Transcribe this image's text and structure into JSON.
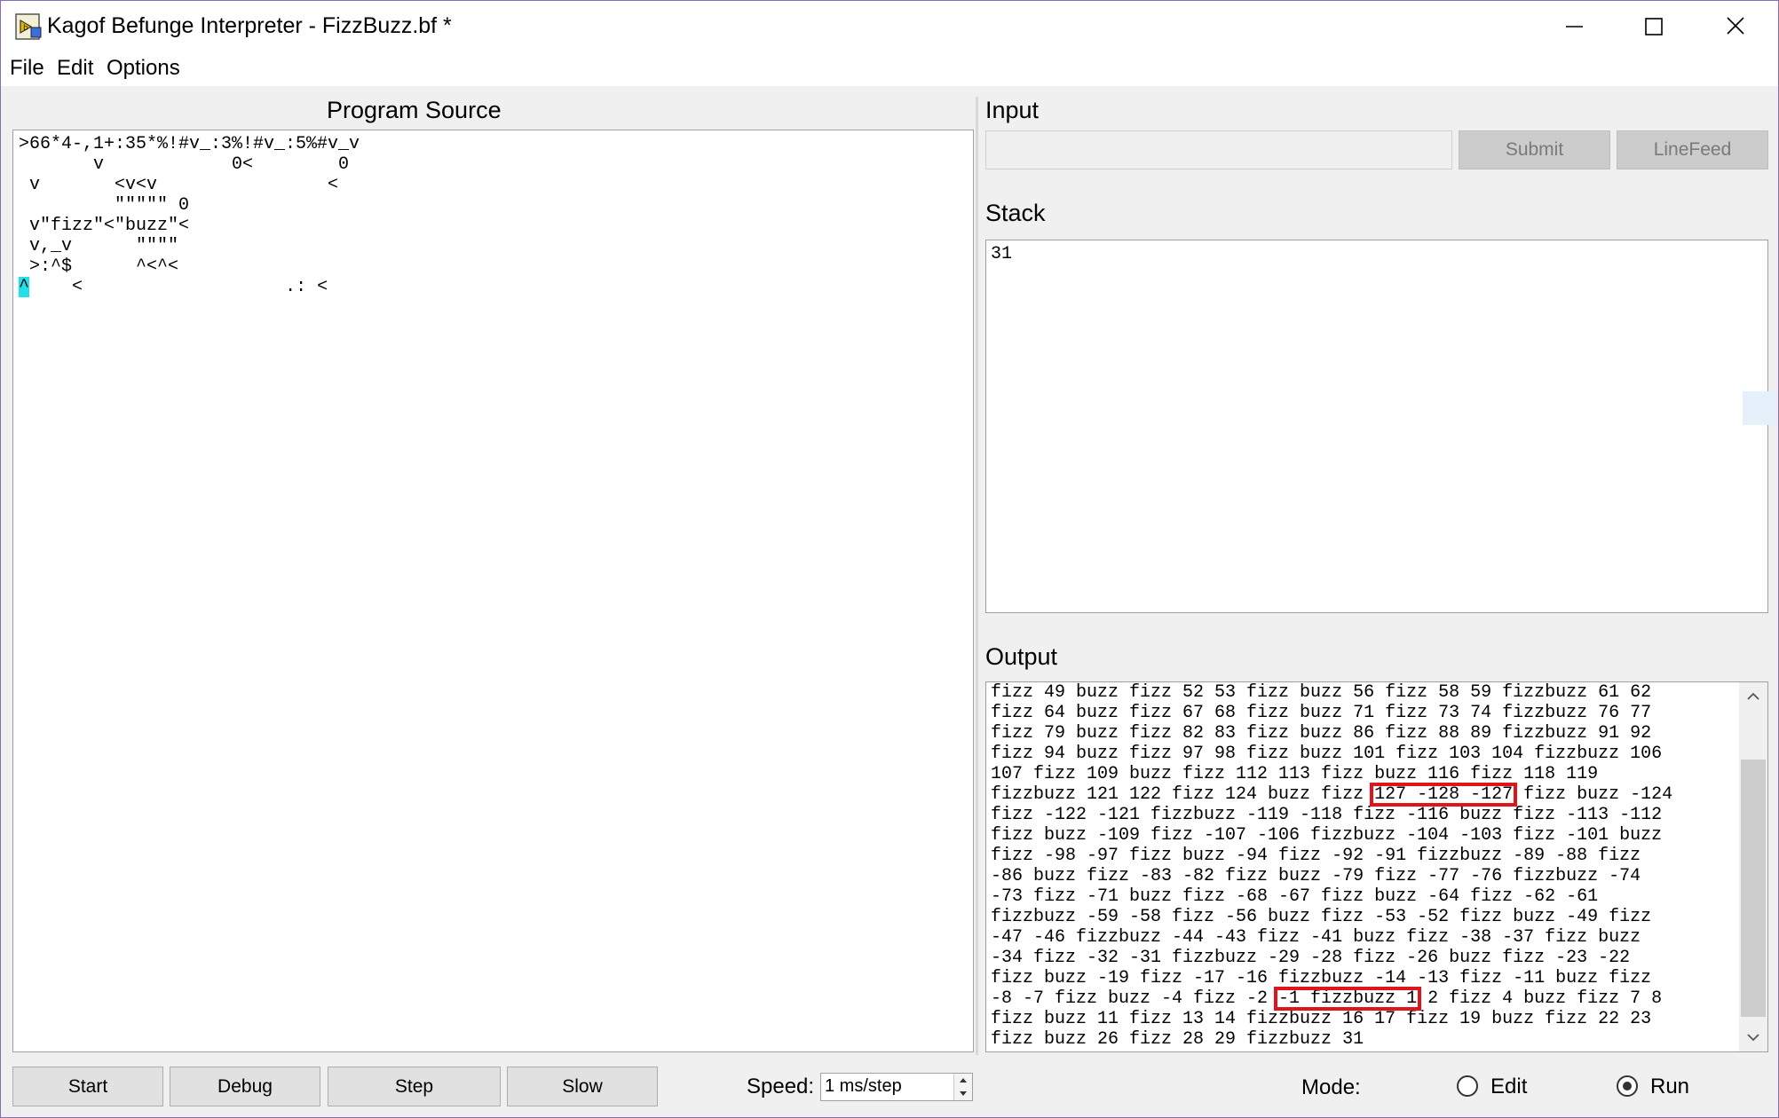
{
  "window": {
    "title": "Kagof Befunge Interpreter - FizzBuzz.bf *",
    "controls": {
      "minimize": "–",
      "maximize": "☐",
      "close": "✕"
    }
  },
  "menu": [
    "File",
    "Edit",
    "Options"
  ],
  "source": {
    "label": "Program Source",
    "lines": [
      ">66*4-,1+:35*%!#v_:3%!#v_:5%#v_v",
      "       v            0<        0",
      " v       <v<v                <",
      "         \"\"\"\"\" 0",
      " v\"fizz\"<\"buzz\"<",
      " v,_v      \"\"\"\"",
      " >:^$      ^<^<",
      "    <                   .: <"
    ],
    "cursor_char": "^"
  },
  "input": {
    "label": "Input",
    "value": "",
    "submit_label": "Submit",
    "linefeed_label": "LineFeed"
  },
  "stack": {
    "label": "Stack",
    "values": "31"
  },
  "output": {
    "label": "Output",
    "lines": [
      "fizz 49 buzz fizz 52 53 fizz buzz 56 fizz 58 59 fizzbuzz 61 62",
      "fizz 64 buzz fizz 67 68 fizz buzz 71 fizz 73 74 fizzbuzz 76 77",
      "fizz 79 buzz fizz 82 83 fizz buzz 86 fizz 88 89 fizzbuzz 91 92",
      "fizz 94 buzz fizz 97 98 fizz buzz 101 fizz 103 104 fizzbuzz 106",
      "107 fizz 109 buzz fizz 112 113 fizz buzz 116 fizz 118 119",
      "fizzbuzz 121 122 fizz 124 buzz fizz 127 -128 -127 fizz buzz -124",
      "fizz -122 -121 fizzbuzz -119 -118 fizz -116 buzz fizz -113 -112",
      "fizz buzz -109 fizz -107 -106 fizzbuzz -104 -103 fizz -101 buzz",
      "fizz -98 -97 fizz buzz -94 fizz -92 -91 fizzbuzz -89 -88 fizz",
      "-86 buzz fizz -83 -82 fizz buzz -79 fizz -77 -76 fizzbuzz -74",
      "-73 fizz -71 buzz fizz -68 -67 fizz buzz -64 fizz -62 -61",
      "fizzbuzz -59 -58 fizz -56 buzz fizz -53 -52 fizz buzz -49 fizz",
      "-47 -46 fizzbuzz -44 -43 fizz -41 buzz fizz -38 -37 fizz buzz",
      "-34 fizz -32 -31 fizzbuzz -29 -28 fizz -26 buzz fizz -23 -22",
      "fizz buzz -19 fizz -17 -16 fizzbuzz -14 -13 fizz -11 buzz fizz",
      "-8 -7 fizz buzz -4 fizz -2 -1 fizzbuzz 1 2 fizz 4 buzz fizz 7 8",
      "fizz buzz 11 fizz 13 14 fizzbuzz 16 17 fizz 19 buzz fizz 22 23",
      "fizz buzz 26 fizz 28 29 fizzbuzz 31"
    ],
    "highlight_color": "#e0151b"
  },
  "controls": {
    "start_label": "Start",
    "debug_label": "Debug",
    "step_label": "Step",
    "slow_label": "Slow",
    "speed_label": "Speed:",
    "speed_value": "1 ms/step",
    "mode_label": "Mode:",
    "mode_edit_label": "Edit",
    "mode_run_label": "Run",
    "selected_mode": "Run"
  }
}
